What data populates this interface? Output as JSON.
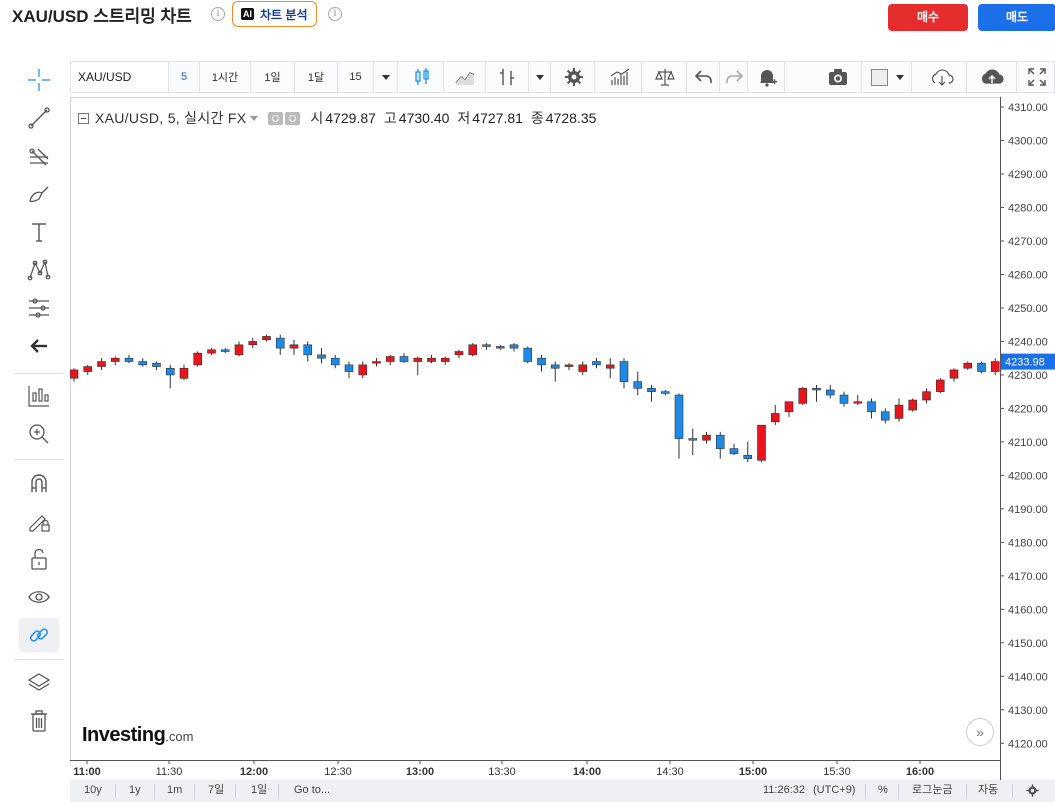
{
  "header": {
    "title": "XAU/USD 스트리밍 차트",
    "ai_badge": "AI",
    "ai_button_label": "차트 분석",
    "info_glyph": "i",
    "buy_label": "매수",
    "sell_label": "매도",
    "buy_color": "#e52d2d",
    "sell_color": "#1b6fe8"
  },
  "toolbar": {
    "symbol": "XAU/USD",
    "intervals": [
      "5",
      "1시간",
      "1일",
      "1달",
      "15"
    ],
    "active_interval": "5",
    "icons": [
      "candles-icon",
      "line-chart-icon",
      "indicator-icon",
      "settings-gear-icon",
      "bars-icon",
      "compare-scale-icon",
      "undo-icon",
      "redo-icon",
      "alert-bell-icon",
      "camera-icon",
      "color-square-icon",
      "cloud-download-icon",
      "cloud-upload-icon",
      "fullscreen-icon"
    ]
  },
  "left_tools": [
    "crosshair-icon",
    "trend-line-icon",
    "fib-tool-icon",
    "brush-icon",
    "text-icon",
    "pattern-icon",
    "prediction-icon",
    "back-arrow-icon",
    "measure-icon",
    "zoom-in-icon",
    "magnet-icon",
    "lock-pencil-icon",
    "unlock-icon",
    "eye-icon",
    "link-icon",
    "layers-icon",
    "trash-icon"
  ],
  "legend": {
    "symbol_text": "XAU/USD, 5, 실시간 FX",
    "open_label": "시",
    "open": "4729.87",
    "high_label": "고",
    "high": "4730.40",
    "low_label": "저",
    "low": "4727.81",
    "close_label": "종",
    "close": "4728.35"
  },
  "logo": {
    "main": "Investing",
    "suffix": ".com"
  },
  "bottom_bar": {
    "ranges": [
      "10y",
      "1y",
      "1m",
      "7일",
      "1일"
    ],
    "goto": "Go to...",
    "time": "11:26:32",
    "timezone": "(UTC+9)",
    "percent": "%",
    "log_scale": "로그눈금",
    "auto": "자동"
  },
  "chart_data": {
    "type": "candlestick",
    "y_ticks": [
      "4310.00",
      "4300.00",
      "4290.00",
      "4280.00",
      "4270.00",
      "4260.00",
      "4250.00",
      "4240.00",
      "4230.00",
      "4220.00",
      "4210.00",
      "4200.00",
      "4190.00",
      "4180.00",
      "4170.00",
      "4160.00",
      "4150.00",
      "4140.00",
      "4130.00",
      "4120.00"
    ],
    "ylim": [
      4115,
      4313
    ],
    "x_ticks": [
      "11:00",
      "11:30",
      "12:00",
      "12:30",
      "13:00",
      "13:30",
      "14:00",
      "14:30",
      "15:00",
      "15:30",
      "16:00"
    ],
    "last_price": "4233.98",
    "up_color": "#e8161c",
    "down_color": "#1e88e5",
    "candles": [
      [
        4229,
        4232,
        4228,
        4231.5
      ],
      [
        4231,
        4233,
        4230,
        4232.5
      ],
      [
        4232.5,
        4235,
        4231.5,
        4234
      ],
      [
        4234,
        4235.5,
        4233,
        4235
      ],
      [
        4235,
        4236,
        4233.5,
        4234
      ],
      [
        4234,
        4235,
        4232.5,
        4233
      ],
      [
        4233.5,
        4234,
        4231.5,
        4232.5
      ],
      [
        4232,
        4233,
        4226,
        4230
      ],
      [
        4229,
        4233,
        4228.5,
        4232
      ],
      [
        4233,
        4237,
        4232.5,
        4236.5
      ],
      [
        4236.5,
        4238,
        4236,
        4237.5
      ],
      [
        4237.5,
        4238,
        4236.5,
        4237
      ],
      [
        4236,
        4240,
        4235.5,
        4239
      ],
      [
        4239,
        4241,
        4238,
        4240
      ],
      [
        4240.5,
        4242,
        4240,
        4241.5
      ],
      [
        4241,
        4242,
        4236,
        4238
      ],
      [
        4238,
        4240.5,
        4236,
        4239
      ],
      [
        4239,
        4240,
        4234,
        4236
      ],
      [
        4236,
        4238,
        4233.5,
        4235
      ],
      [
        4235,
        4236,
        4232,
        4233
      ],
      [
        4233,
        4234,
        4229,
        4231
      ],
      [
        4230,
        4234,
        4229,
        4233
      ],
      [
        4233.5,
        4235,
        4232.5,
        4234
      ],
      [
        4234,
        4236,
        4233,
        4235.5
      ],
      [
        4235.5,
        4236.5,
        4233.5,
        4234
      ],
      [
        4234,
        4235.5,
        4230,
        4235
      ],
      [
        4234,
        4236,
        4233.5,
        4235
      ],
      [
        4234,
        4235.5,
        4233,
        4235
      ],
      [
        4236,
        4237.5,
        4235,
        4237
      ],
      [
        4236,
        4239.5,
        4235.5,
        4239
      ],
      [
        4239,
        4239.5,
        4237.5,
        4238.5
      ],
      [
        4238.5,
        4239,
        4237.5,
        4238
      ],
      [
        4239,
        4239.5,
        4237,
        4238
      ],
      [
        4238,
        4238.5,
        4233.5,
        4234
      ],
      [
        4235,
        4236,
        4231,
        4233
      ],
      [
        4233,
        4234,
        4228,
        4232
      ],
      [
        4232.5,
        4233.5,
        4231.5,
        4233
      ],
      [
        4231,
        4234,
        4230,
        4233
      ],
      [
        4234,
        4235,
        4232,
        4233
      ],
      [
        4232,
        4235,
        4229,
        4233
      ],
      [
        4234,
        4235,
        4226,
        4228
      ],
      [
        4228,
        4231,
        4224,
        4226
      ],
      [
        4226,
        4227,
        4222,
        4225
      ],
      [
        4225,
        4225.5,
        4224,
        4224.5
      ],
      [
        4224,
        4224.5,
        4205,
        4211
      ],
      [
        4211,
        4214,
        4206,
        4210.5
      ],
      [
        4210.5,
        4213,
        4209.5,
        4212
      ],
      [
        4212,
        4213,
        4205,
        4208
      ],
      [
        4208,
        4209.5,
        4206,
        4206.5
      ],
      [
        4206,
        4210,
        4204,
        4205
      ],
      [
        4204.5,
        4214,
        4204,
        4215
      ],
      [
        4216,
        4221,
        4215,
        4218.5
      ],
      [
        4219,
        4222,
        4217.5,
        4222
      ],
      [
        4221.5,
        4226.5,
        4221,
        4226
      ],
      [
        4226,
        4227,
        4222,
        4225.5
      ],
      [
        4225.5,
        4227,
        4223,
        4224
      ],
      [
        4224,
        4225,
        4220.5,
        4221.5
      ],
      [
        4222,
        4224,
        4221,
        4222
      ],
      [
        4222,
        4223,
        4217,
        4219
      ],
      [
        4219,
        4220,
        4215.5,
        4216.5
      ],
      [
        4217,
        4223,
        4216,
        4221
      ],
      [
        4219.5,
        4223,
        4219,
        4222.5
      ],
      [
        4222.5,
        4226,
        4221.5,
        4225
      ],
      [
        4225,
        4229,
        4224.5,
        4228.5
      ],
      [
        4229,
        4232,
        4228,
        4231.5
      ],
      [
        4232,
        4234,
        4231.5,
        4233.5
      ],
      [
        4233.5,
        4234,
        4230.5,
        4231
      ],
      [
        4231,
        4235,
        4230,
        4234
      ]
    ]
  }
}
